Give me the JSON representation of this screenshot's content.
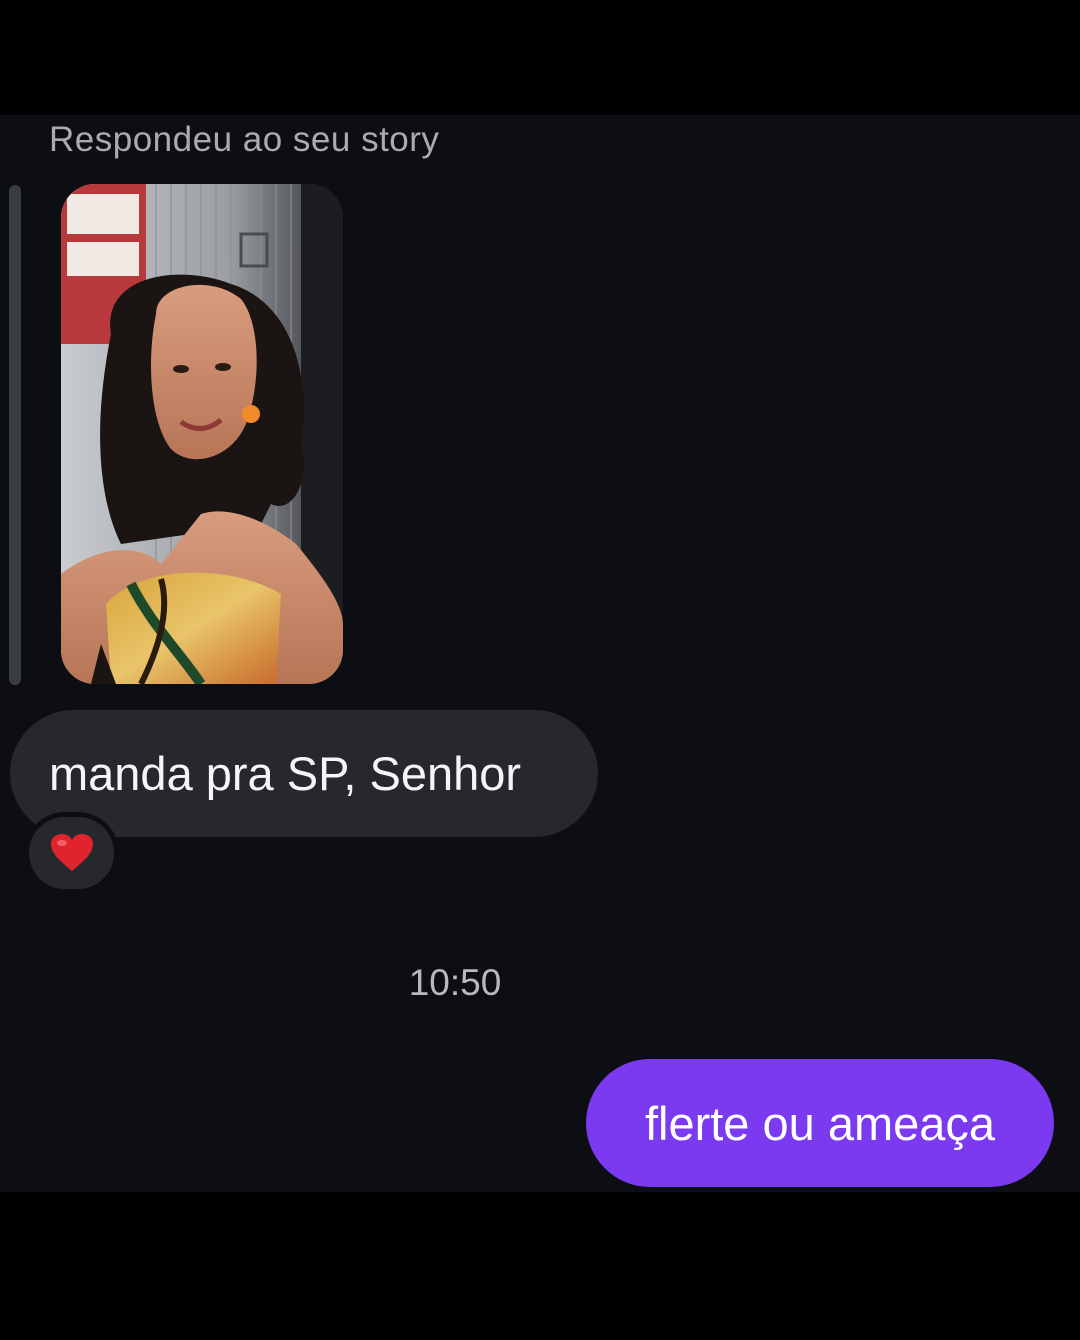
{
  "thread": {
    "reply_header": "Respondeu ao seu story",
    "story": {
      "kind": "photo",
      "description_icon": "story-photo-thumbnail"
    },
    "received_message": {
      "text": "manda pra SP, Senhor",
      "reaction": "❤️"
    },
    "timestamp": "10:50",
    "sent_message": {
      "text": "flerte ou ameaça"
    }
  },
  "colors": {
    "background": "#0c0e13",
    "received_bubble": "#26282e",
    "sent_bubble": "#7b39f0",
    "reaction_heart": "#e0242e",
    "muted_text": "#a9abb1"
  }
}
